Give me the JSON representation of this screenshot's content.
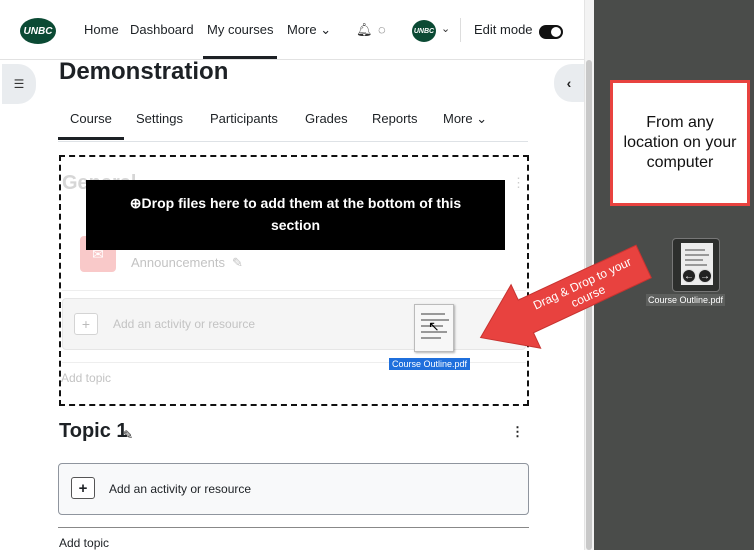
{
  "navbar": {
    "logo_text": "UNBC",
    "links": [
      "Home",
      "Dashboard",
      "My courses",
      "More ⌄"
    ],
    "active_link": "My courses",
    "notifications_icon": "bell-icon",
    "messages_icon": "chat-icon",
    "avatar_text": "UNBC",
    "avatar_caret": "⌄",
    "edit_mode_label": "Edit mode",
    "edit_mode_on": true
  },
  "drawer": {
    "open_icon": "list-icon",
    "collapse_icon": "chevron-left-icon",
    "collapse_glyph": "‹"
  },
  "course": {
    "title": "Demonstration",
    "tabs": [
      "Course",
      "Settings",
      "Participants",
      "Grades",
      "Reports",
      "More ⌄"
    ],
    "active_tab": "Course"
  },
  "general_section": {
    "title": "General",
    "announcements_label": "Announcements",
    "add_activity_label": "Add an activity or resource",
    "add_topic_label": "Add topic",
    "drop_message": "⊕Drop files here to add them at the bottom of this section"
  },
  "drag": {
    "file_name": "Course Outline.pdf",
    "arrow_text_line1": "Drag & Drop to your",
    "arrow_text_line2": "course",
    "callout_text": "From any location on your computer",
    "desktop_file_name": "Course Outline.pdf"
  },
  "topic1": {
    "title": "Topic 1",
    "add_activity_label": "Add an activity or resource",
    "add_topic_label": "Add topic"
  },
  "colors": {
    "brand": "#0b4a34",
    "arrow": "#e8423f",
    "selection": "#1f6fdc"
  }
}
